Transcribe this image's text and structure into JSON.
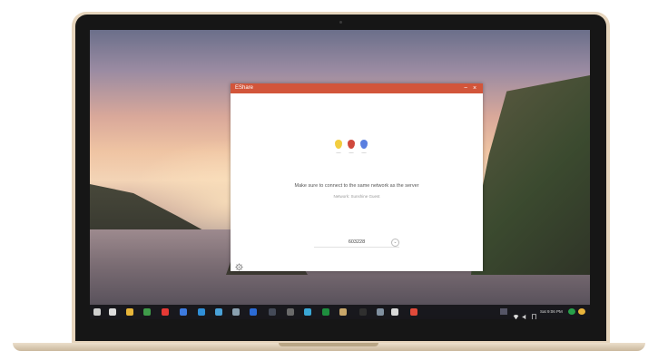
{
  "window": {
    "app_title": "EShare",
    "minimize": "−",
    "close": "×"
  },
  "content": {
    "message": "Make sure to connect to the same network as the server",
    "network": "Network: Sunshine Guest",
    "code": "603228",
    "dropdown_glyph": "⌄"
  },
  "dots": [
    {
      "color": "#f2cd3f",
      "icon": "yellow-pin-icon"
    },
    {
      "color": "#d0483c",
      "icon": "red-pin-icon"
    },
    {
      "color": "#5a7fe0",
      "icon": "blue-pin-icon"
    }
  ],
  "taskbar": {
    "apps": [
      {
        "icon": "launcher-icon",
        "color": "#cfcfcf"
      },
      {
        "icon": "files-icon",
        "color": "#dcdcdc"
      },
      {
        "icon": "chrome-icon",
        "color": "#e7b53a"
      },
      {
        "icon": "drive-icon",
        "color": "#3f9b4a"
      },
      {
        "icon": "youtube-icon",
        "color": "#e53935"
      },
      {
        "icon": "docs-icon",
        "color": "#3d7be0"
      },
      {
        "icon": "store-icon",
        "color": "#2f8fd8"
      },
      {
        "icon": "app-icon",
        "color": "#4aa2d9"
      },
      {
        "icon": "calc-icon",
        "color": "#8aa0b0"
      },
      {
        "icon": "check-icon",
        "color": "#2b6bd6"
      },
      {
        "icon": "app2-icon",
        "color": "#444a58"
      },
      {
        "icon": "pen-icon",
        "color": "#6a6a6a"
      },
      {
        "icon": "photos-icon",
        "color": "#3aa7d6"
      },
      {
        "icon": "sheets-icon",
        "color": "#1e8e3e"
      },
      {
        "icon": "folder-icon",
        "color": "#c9a76a"
      },
      {
        "icon": "terminal-icon",
        "color": "#2f2f2f"
      },
      {
        "icon": "window-icon",
        "color": "#8090a0"
      },
      {
        "icon": "box-icon",
        "color": "#d9d9d9"
      },
      {
        "icon": "presentation-icon",
        "color": "#e04a3a"
      }
    ],
    "time": "Sat 9:06 PM"
  }
}
